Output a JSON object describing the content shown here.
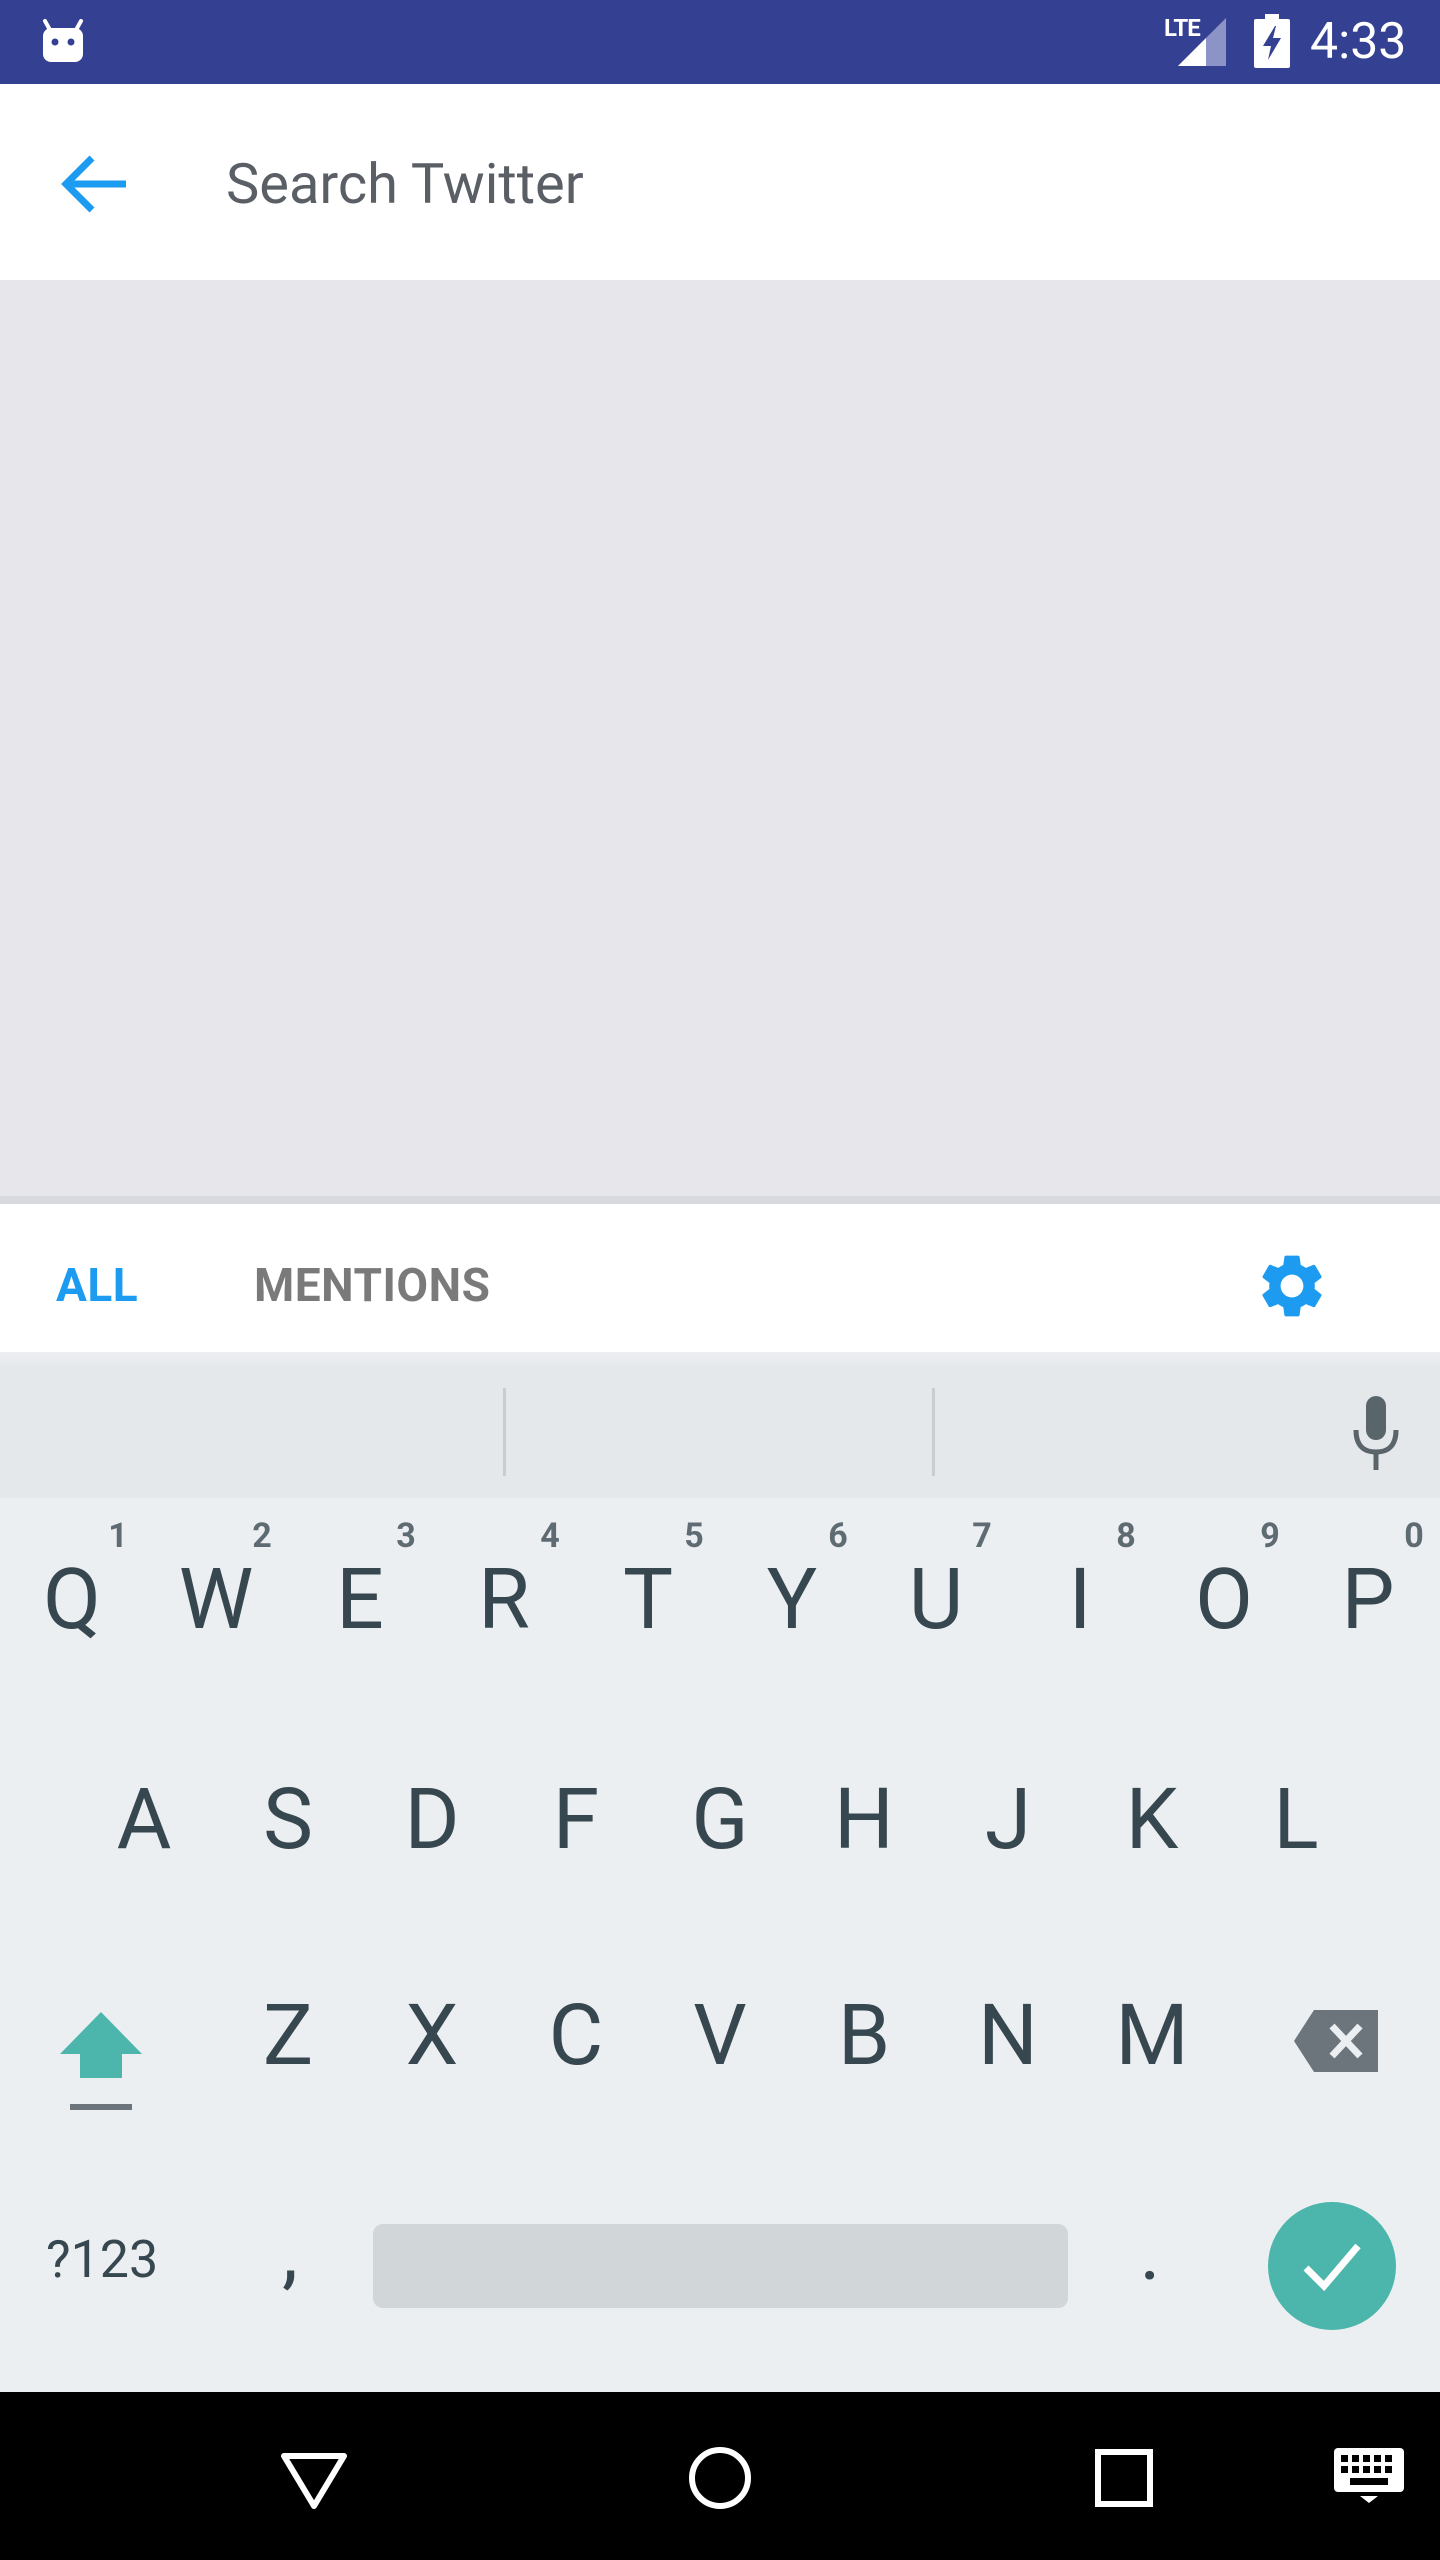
{
  "status_bar": {
    "network": "LTE",
    "time": "4:33",
    "android_icon": "android-notification-icon",
    "signal_icon": "signal-icon",
    "battery_icon": "battery-charging-icon",
    "background": "#344193"
  },
  "toolbar": {
    "back_icon": "arrow-back-icon",
    "search_placeholder": "Search Twitter",
    "accent": "#1d9bf0"
  },
  "tabs": {
    "all_label": "ALL",
    "mentions_label": "MENTIONS",
    "selected": "ALL",
    "settings_icon": "gear-icon"
  },
  "keyboard": {
    "row1": [
      {
        "key": "Q",
        "hint": "1"
      },
      {
        "key": "W",
        "hint": "2"
      },
      {
        "key": "E",
        "hint": "3"
      },
      {
        "key": "R",
        "hint": "4"
      },
      {
        "key": "T",
        "hint": "5"
      },
      {
        "key": "Y",
        "hint": "6"
      },
      {
        "key": "U",
        "hint": "7"
      },
      {
        "key": "I",
        "hint": "8"
      },
      {
        "key": "O",
        "hint": "9"
      },
      {
        "key": "P",
        "hint": "0"
      }
    ],
    "row2": [
      "A",
      "S",
      "D",
      "F",
      "G",
      "H",
      "J",
      "K",
      "L"
    ],
    "row3": [
      "Z",
      "X",
      "C",
      "V",
      "B",
      "N",
      "M"
    ],
    "symbols_label": "?123",
    "comma": ",",
    "period": ".",
    "shift_icon": "shift-icon",
    "backspace_icon": "backspace-icon",
    "enter_icon": "checkmark-icon",
    "mic_icon": "microphone-icon",
    "enter_color": "#4db6ac"
  },
  "nav_bar": {
    "back_icon": "nav-back-triangle-icon",
    "home_icon": "nav-home-circle-icon",
    "recents_icon": "nav-recents-square-icon",
    "keyboard_icon": "keyboard-icon"
  }
}
